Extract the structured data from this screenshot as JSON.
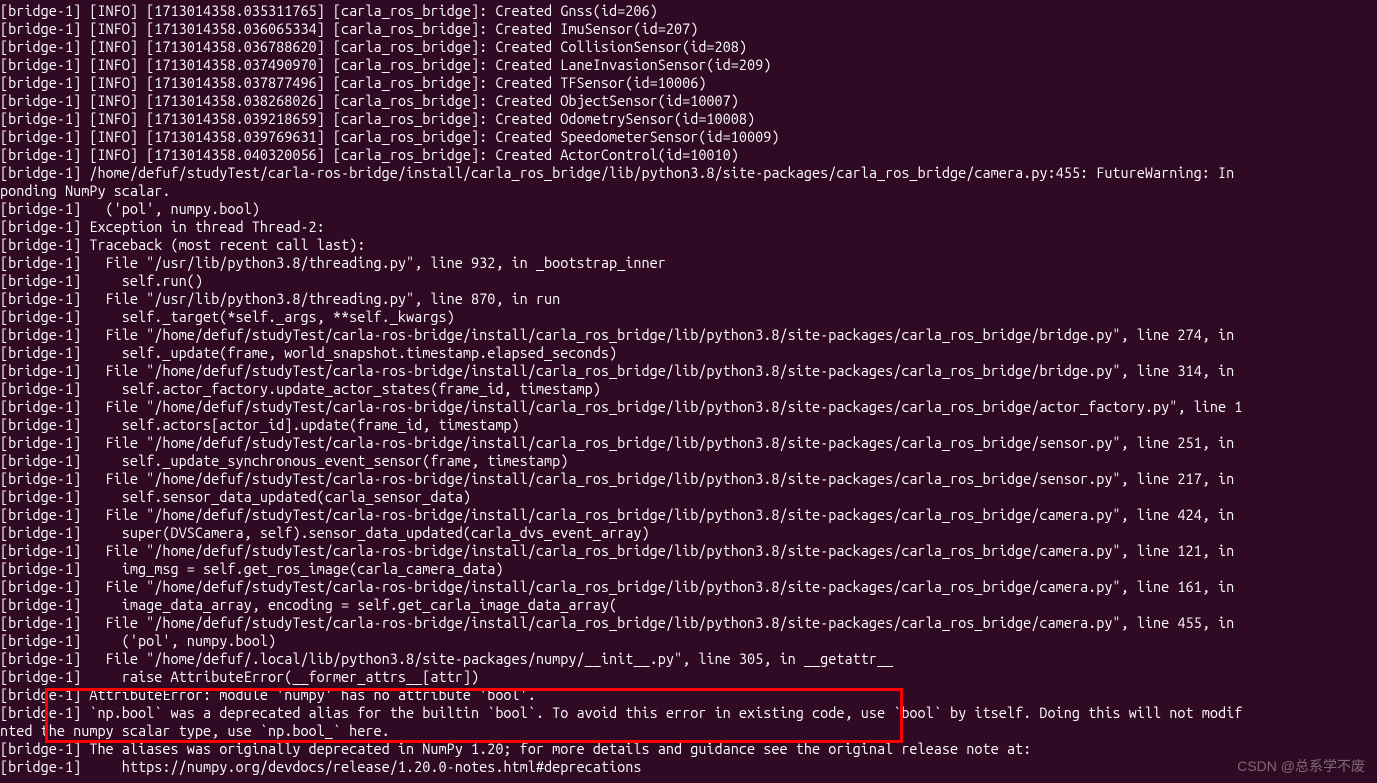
{
  "lines": [
    "[bridge-1] [INFO] [1713014358.035311765] [carla_ros_bridge]: Created Gnss(id=206)",
    "[bridge-1] [INFO] [1713014358.036065334] [carla_ros_bridge]: Created ImuSensor(id=207)",
    "[bridge-1] [INFO] [1713014358.036788620] [carla_ros_bridge]: Created CollisionSensor(id=208)",
    "[bridge-1] [INFO] [1713014358.037490970] [carla_ros_bridge]: Created LaneInvasionSensor(id=209)",
    "[bridge-1] [INFO] [1713014358.037877496] [carla_ros_bridge]: Created TFSensor(id=10006)",
    "[bridge-1] [INFO] [1713014358.038268026] [carla_ros_bridge]: Created ObjectSensor(id=10007)",
    "[bridge-1] [INFO] [1713014358.039218659] [carla_ros_bridge]: Created OdometrySensor(id=10008)",
    "[bridge-1] [INFO] [1713014358.039769631] [carla_ros_bridge]: Created SpeedometerSensor(id=10009)",
    "[bridge-1] [INFO] [1713014358.040320056] [carla_ros_bridge]: Created ActorControl(id=10010)",
    "[bridge-1] /home/defuf/studyTest/carla-ros-bridge/install/carla_ros_bridge/lib/python3.8/site-packages/carla_ros_bridge/camera.py:455: FutureWarning: In ",
    "ponding NumPy scalar.",
    "[bridge-1]   ('pol', numpy.bool)",
    "[bridge-1] Exception in thread Thread-2:",
    "[bridge-1] Traceback (most recent call last):",
    "[bridge-1]   File \"/usr/lib/python3.8/threading.py\", line 932, in _bootstrap_inner",
    "[bridge-1]     self.run()",
    "[bridge-1]   File \"/usr/lib/python3.8/threading.py\", line 870, in run",
    "[bridge-1]     self._target(*self._args, **self._kwargs)",
    "[bridge-1]   File \"/home/defuf/studyTest/carla-ros-bridge/install/carla_ros_bridge/lib/python3.8/site-packages/carla_ros_bridge/bridge.py\", line 274, in ",
    "[bridge-1]     self._update(frame, world_snapshot.timestamp.elapsed_seconds)",
    "[bridge-1]   File \"/home/defuf/studyTest/carla-ros-bridge/install/carla_ros_bridge/lib/python3.8/site-packages/carla_ros_bridge/bridge.py\", line 314, in ",
    "[bridge-1]     self.actor_factory.update_actor_states(frame_id, timestamp)",
    "[bridge-1]   File \"/home/defuf/studyTest/carla-ros-bridge/install/carla_ros_bridge/lib/python3.8/site-packages/carla_ros_bridge/actor_factory.py\", line 1",
    "[bridge-1]     self.actors[actor_id].update(frame_id, timestamp)",
    "[bridge-1]   File \"/home/defuf/studyTest/carla-ros-bridge/install/carla_ros_bridge/lib/python3.8/site-packages/carla_ros_bridge/sensor.py\", line 251, in ",
    "[bridge-1]     self._update_synchronous_event_sensor(frame, timestamp)",
    "[bridge-1]   File \"/home/defuf/studyTest/carla-ros-bridge/install/carla_ros_bridge/lib/python3.8/site-packages/carla_ros_bridge/sensor.py\", line 217, in ",
    "[bridge-1]     self.sensor_data_updated(carla_sensor_data)",
    "[bridge-1]   File \"/home/defuf/studyTest/carla-ros-bridge/install/carla_ros_bridge/lib/python3.8/site-packages/carla_ros_bridge/camera.py\", line 424, in ",
    "[bridge-1]     super(DVSCamera, self).sensor_data_updated(carla_dvs_event_array)",
    "[bridge-1]   File \"/home/defuf/studyTest/carla-ros-bridge/install/carla_ros_bridge/lib/python3.8/site-packages/carla_ros_bridge/camera.py\", line 121, in ",
    "[bridge-1]     img_msg = self.get_ros_image(carla_camera_data)",
    "[bridge-1]   File \"/home/defuf/studyTest/carla-ros-bridge/install/carla_ros_bridge/lib/python3.8/site-packages/carla_ros_bridge/camera.py\", line 161, in ",
    "[bridge-1]     image_data_array, encoding = self.get_carla_image_data_array(",
    "[bridge-1]   File \"/home/defuf/studyTest/carla-ros-bridge/install/carla_ros_bridge/lib/python3.8/site-packages/carla_ros_bridge/camera.py\", line 455, in ",
    "[bridge-1]     ('pol', numpy.bool)",
    "[bridge-1]   File \"/home/defuf/.local/lib/python3.8/site-packages/numpy/__init__.py\", line 305, in __getattr__",
    "[bridge-1]     raise AttributeError(__former_attrs__[attr])",
    "[bridge-1] AttributeError: module 'numpy' has no attribute 'bool'.",
    "[bridge-1] `np.bool` was a deprecated alias for the builtin `bool`. To avoid this error in existing code, use `bool` by itself. Doing this will not modif",
    "nted the numpy scalar type, use `np.bool_` here.",
    "[bridge-1] The aliases was originally deprecated in NumPy 1.20; for more details and guidance see the original release note at:",
    "[bridge-1]     https://numpy.org/devdocs/release/1.20.0-notes.html#deprecations"
  ],
  "watermark": "CSDN @总系学不废"
}
